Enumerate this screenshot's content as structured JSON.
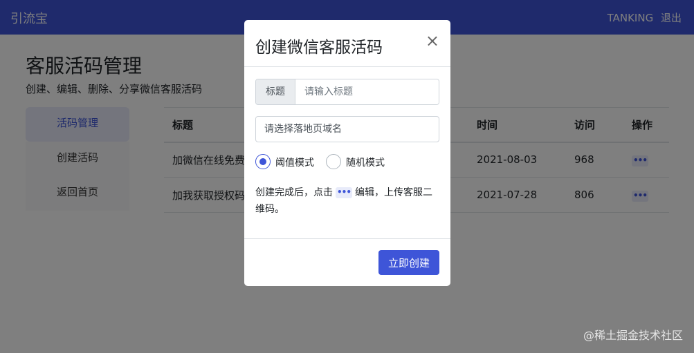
{
  "topbar": {
    "brand": "引流宝",
    "username": "TANKING",
    "logout": "退出"
  },
  "page": {
    "title": "客服活码管理",
    "subtitle": "创建、编辑、删除、分享微信客服活码"
  },
  "sidebar": {
    "items": [
      {
        "label": "活码管理"
      },
      {
        "label": "创建活码"
      },
      {
        "label": "返回首页"
      }
    ]
  },
  "table": {
    "headers": {
      "title": "标题",
      "time": "时间",
      "visits": "访问",
      "actions": "操作"
    },
    "rows": [
      {
        "title": "加微信在线免费",
        "time": "2021-08-03",
        "visits": "968",
        "action": "•••"
      },
      {
        "title": "加我获取授权码",
        "time": "2021-07-28",
        "visits": "806",
        "action": "•••"
      }
    ]
  },
  "modal": {
    "title": "创建微信客服活码",
    "close": "×",
    "title_label": "标题",
    "title_placeholder": "请输入标题",
    "domain_placeholder": "请选择落地页域名",
    "radios": [
      {
        "label": "阈值模式",
        "checked": true
      },
      {
        "label": "随机模式",
        "checked": false
      }
    ],
    "hint_before": "创建完成后，点击",
    "hint_icon": "•••",
    "hint_after": "编辑，上传客服二维码。",
    "submit": "立即创建"
  },
  "watermark": "@稀土掘金技术社区",
  "colors": {
    "primary": "#3e55d8",
    "overlay": "rgba(0,0,0,0.5)"
  }
}
